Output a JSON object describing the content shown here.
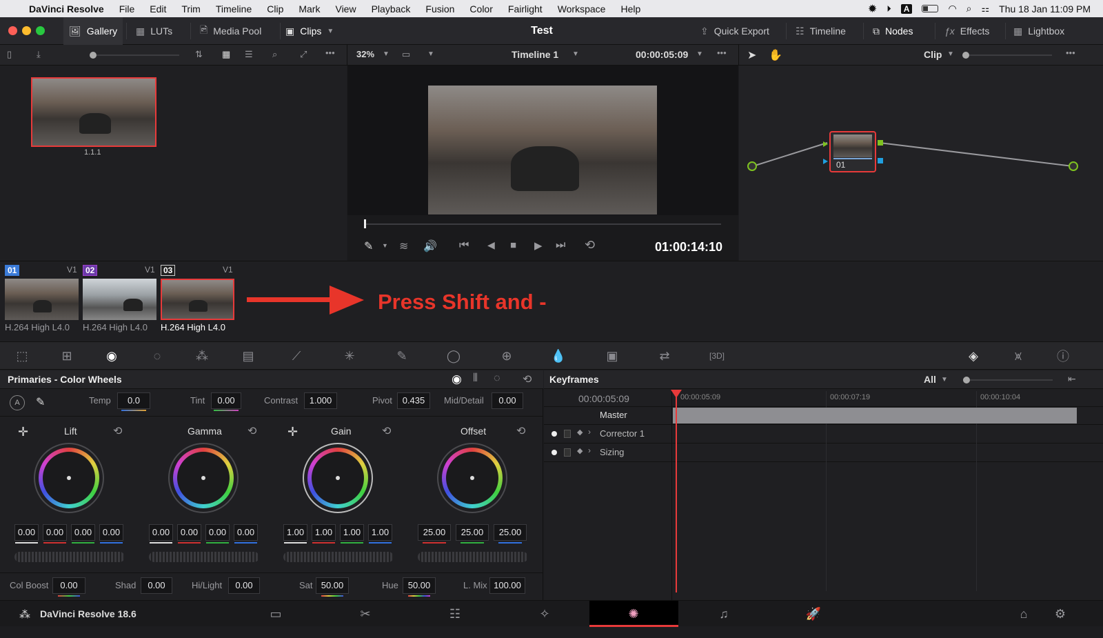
{
  "menubar": {
    "app": "DaVinci Resolve",
    "items": [
      "File",
      "Edit",
      "Trim",
      "Timeline",
      "Clip",
      "Mark",
      "View",
      "Playback",
      "Fusion",
      "Color",
      "Fairlight",
      "Workspace",
      "Help"
    ],
    "clock": "Thu 18 Jan  11:09 PM",
    "input_badge": "A"
  },
  "titlebar": {
    "gallery": "Gallery",
    "luts": "LUTs",
    "media_pool": "Media Pool",
    "clips": "Clips",
    "project_title": "Test",
    "quick_export": "Quick Export",
    "timeline": "Timeline",
    "nodes": "Nodes",
    "effects": "Effects",
    "lightbox": "Lightbox"
  },
  "viewer": {
    "zoom": "32%",
    "timeline_name": "Timeline 1",
    "timecode_top": "00:00:05:09",
    "timecode_main": "01:00:14:10",
    "playhead_fraction": 0.0
  },
  "node_panel": {
    "mode": "Clip",
    "node_label": "01"
  },
  "gallery": {
    "still_label": "1.1.1"
  },
  "clips": [
    {
      "num": "01",
      "track": "V1",
      "codec": "H.264 High L4.0",
      "num_color": "#3b7bd8"
    },
    {
      "num": "02",
      "track": "V1",
      "codec": "H.264 High L4.0",
      "num_color": "#a040d0"
    },
    {
      "num": "03",
      "track": "V1",
      "codec": "H.264 High L4.0",
      "num_color": "#222222"
    }
  ],
  "annotation": {
    "text": "Press Shift and -",
    "color": "#e8352a"
  },
  "primaries": {
    "title": "Primaries - Color Wheels",
    "temp_label": "Temp",
    "temp": "0.0",
    "tint_label": "Tint",
    "tint": "0.00",
    "contrast_label": "Contrast",
    "contrast": "1.000",
    "pivot_label": "Pivot",
    "pivot": "0.435",
    "middetail_label": "Mid/Detail",
    "middetail": "0.00",
    "wheels": [
      {
        "name": "Lift",
        "values": [
          "0.00",
          "0.00",
          "0.00",
          "0.00"
        ]
      },
      {
        "name": "Gamma",
        "values": [
          "0.00",
          "0.00",
          "0.00",
          "0.00"
        ]
      },
      {
        "name": "Gain",
        "values": [
          "1.00",
          "1.00",
          "1.00",
          "1.00"
        ]
      },
      {
        "name": "Offset",
        "values": [
          "25.00",
          "25.00",
          "25.00"
        ]
      }
    ],
    "colboost_label": "Col Boost",
    "colboost": "0.00",
    "shad_label": "Shad",
    "shad": "0.00",
    "hilight_label": "Hi/Light",
    "hilight": "0.00",
    "sat_label": "Sat",
    "sat": "50.00",
    "hue_label": "Hue",
    "hue": "50.00",
    "lmix_label": "L. Mix",
    "lmix": "100.00"
  },
  "keyframes": {
    "title": "Keyframes",
    "filter": "All",
    "timecode": "00:00:05:09",
    "ruler": [
      "00:00:05:09",
      "00:00:07:19",
      "00:00:10:04"
    ],
    "tracks": [
      "Master",
      "Corrector 1",
      "Sizing"
    ]
  },
  "footer": {
    "app_version": "DaVinci Resolve 18.6"
  }
}
